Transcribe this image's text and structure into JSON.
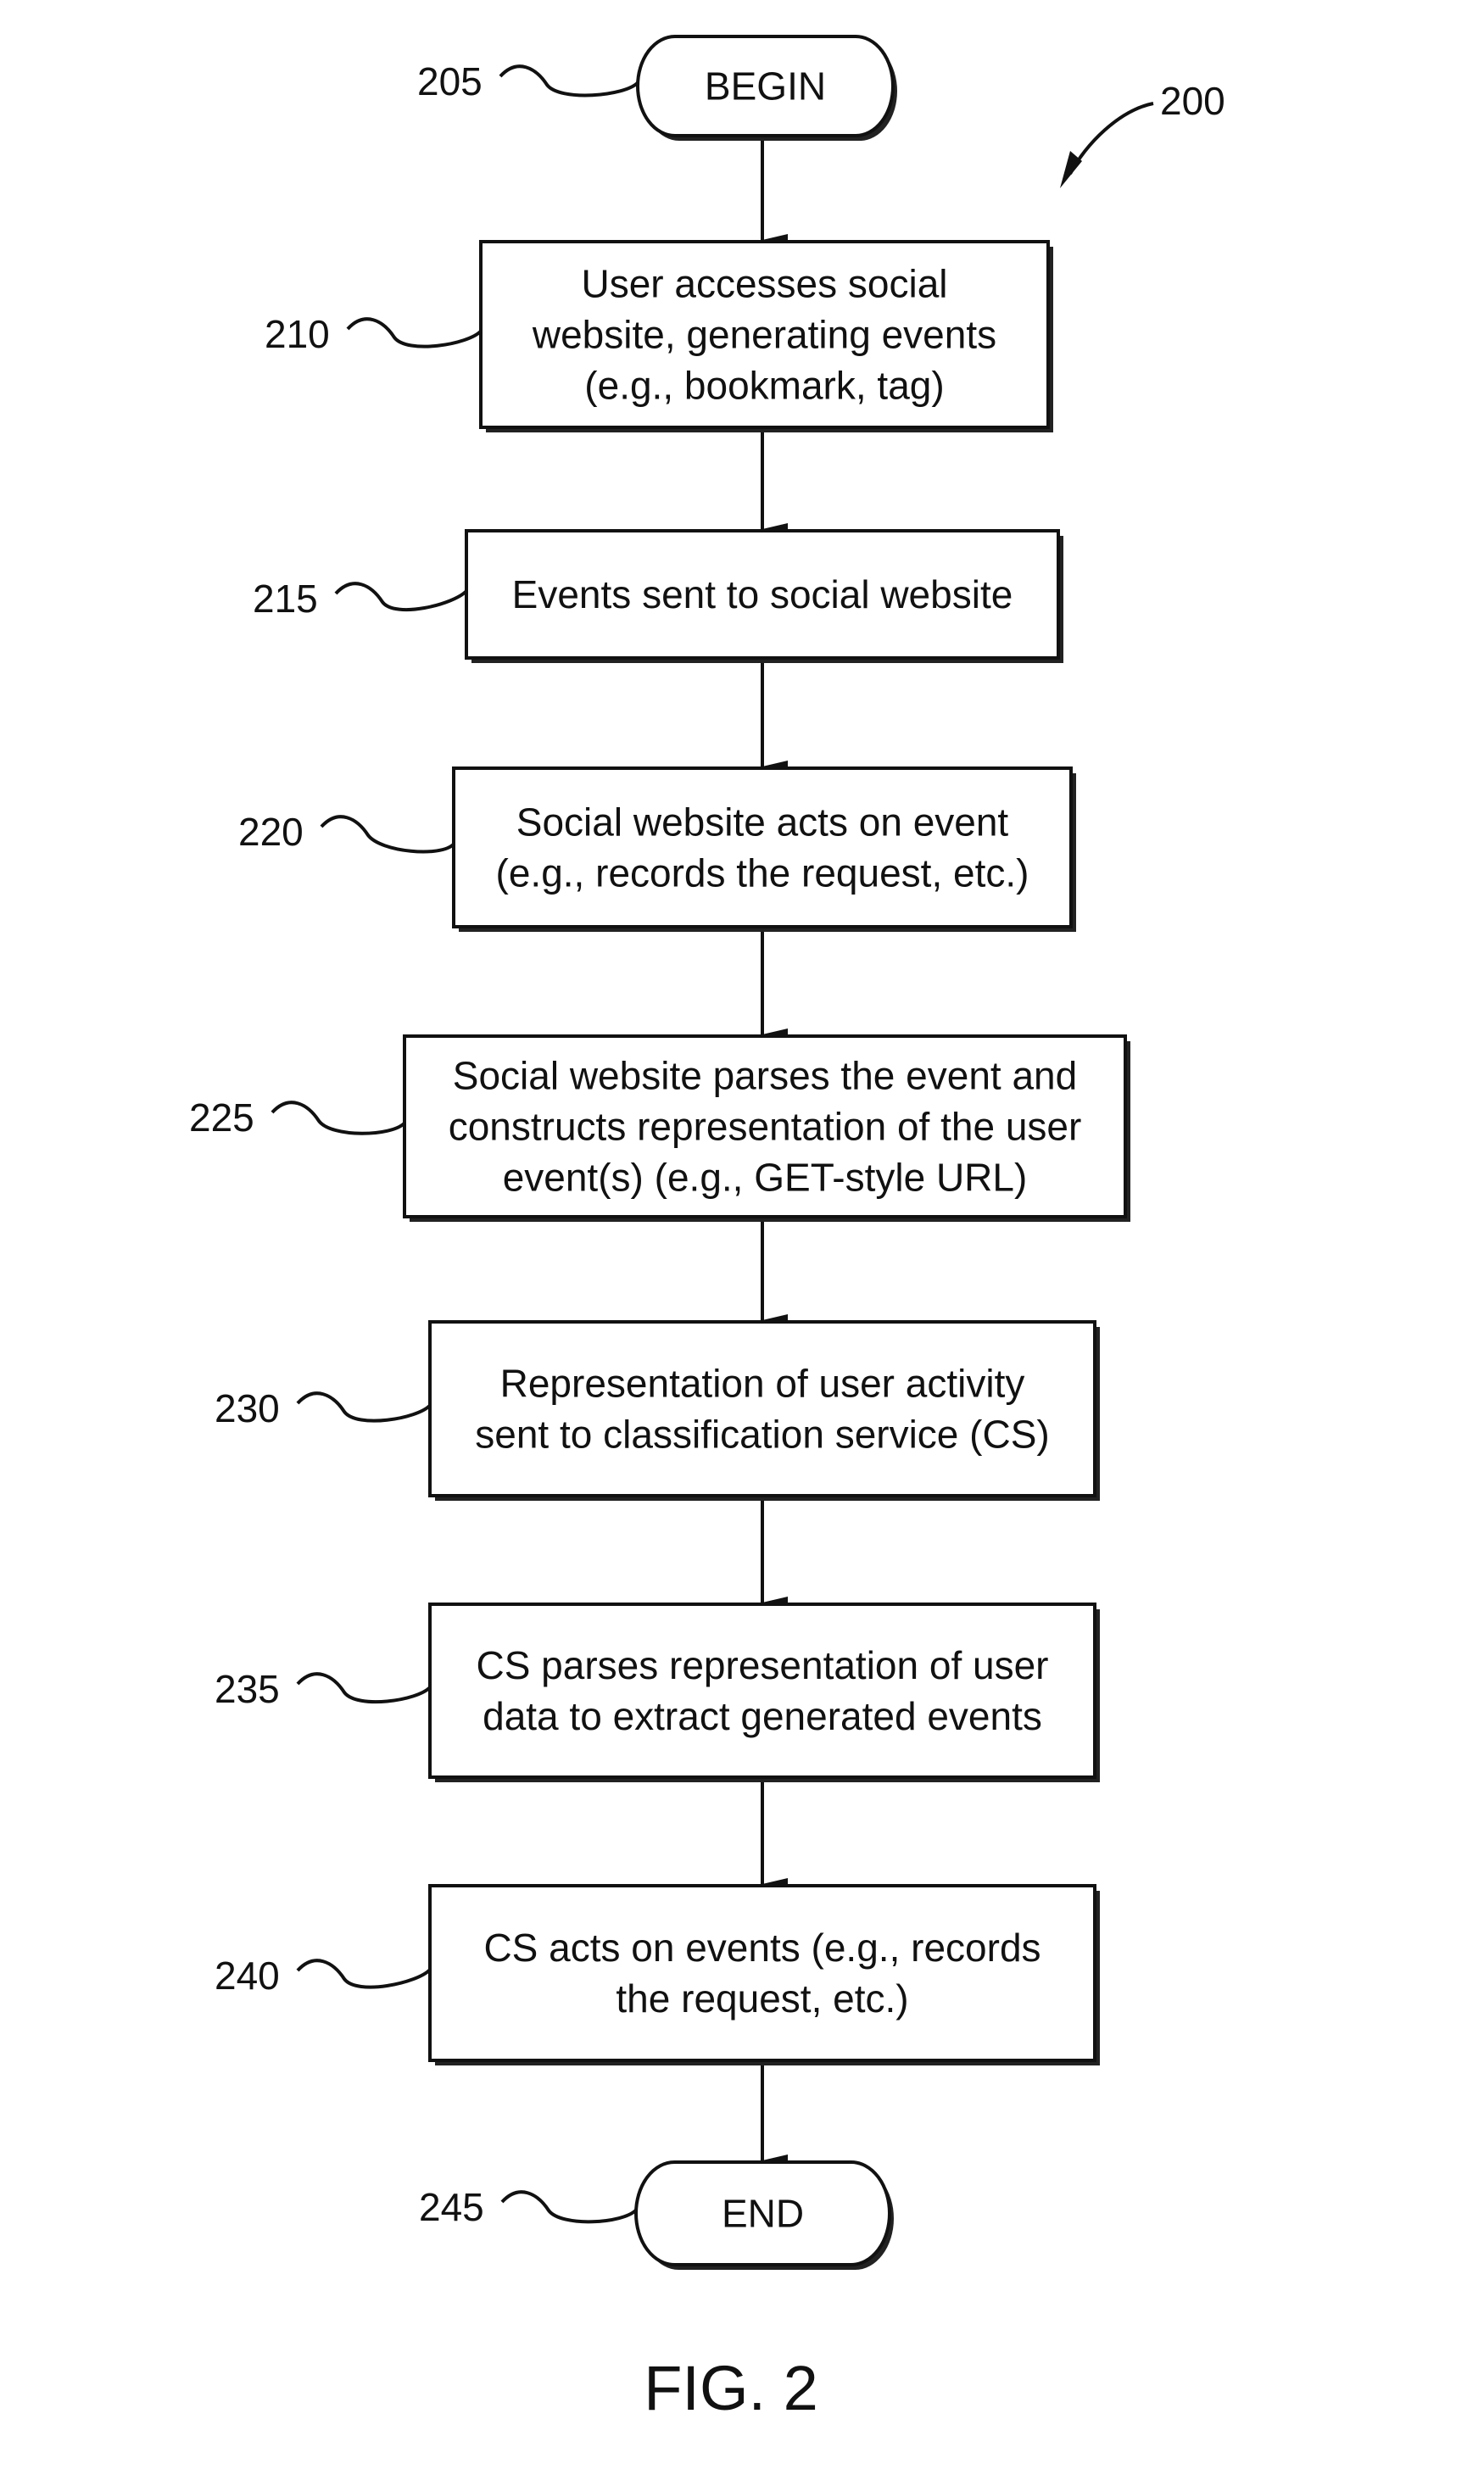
{
  "figure": {
    "reference": "200",
    "caption": "FIG. 2"
  },
  "nodes": [
    {
      "id": "205",
      "type": "terminal",
      "lines": [
        "BEGIN"
      ]
    },
    {
      "id": "210",
      "type": "process",
      "lines": [
        "User accesses social",
        "website, generating events",
        "(e.g., bookmark, tag)"
      ]
    },
    {
      "id": "215",
      "type": "process",
      "lines": [
        "Events sent to social website"
      ]
    },
    {
      "id": "220",
      "type": "process",
      "lines": [
        "Social website acts on event",
        "(e.g., records the request, etc.)"
      ]
    },
    {
      "id": "225",
      "type": "process",
      "lines": [
        "Social website parses the event and",
        "constructs representation of the user",
        "event(s) (e.g., GET-style URL)"
      ]
    },
    {
      "id": "230",
      "type": "process",
      "lines": [
        "Representation of user activity",
        "sent to classification service (CS)"
      ]
    },
    {
      "id": "235",
      "type": "process",
      "lines": [
        "CS parses representation of user",
        "data to extract generated events"
      ]
    },
    {
      "id": "240",
      "type": "process",
      "lines": [
        "CS acts on events (e.g., records",
        "the request, etc.)"
      ]
    },
    {
      "id": "245",
      "type": "terminal",
      "lines": [
        "END"
      ]
    }
  ],
  "edges": [
    [
      "205",
      "210"
    ],
    [
      "210",
      "215"
    ],
    [
      "215",
      "220"
    ],
    [
      "220",
      "225"
    ],
    [
      "225",
      "230"
    ],
    [
      "230",
      "235"
    ],
    [
      "235",
      "240"
    ],
    [
      "240",
      "245"
    ]
  ]
}
